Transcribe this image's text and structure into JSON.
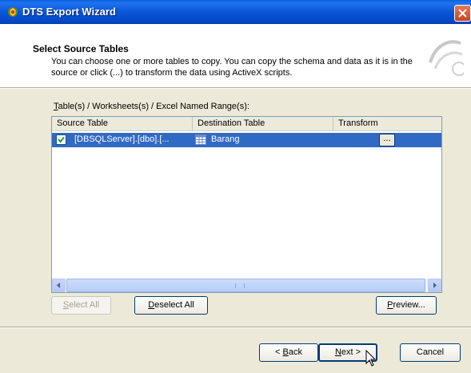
{
  "window": {
    "title": "DTS Export Wizard"
  },
  "header": {
    "title": "Select Source Tables",
    "description_line1": "You can choose one or more tables to copy.  You can copy the schema and data as it is in the",
    "description_line2": "source or click (...) to transform the data using ActiveX scripts."
  },
  "list": {
    "caption_accel": "T",
    "caption_rest": "able(s) / Worksheets(s) / Excel Named Range(s):",
    "columns": [
      "Source Table",
      "Destination Table",
      "Transform"
    ],
    "rows": [
      {
        "checked": true,
        "source": "[DBSQLServer].[dbo].[...",
        "destination": "Barang",
        "transform_button": "..."
      }
    ]
  },
  "buttons": {
    "select_all_accel": "S",
    "select_all_rest": "elect All",
    "deselect_all_accel": "D",
    "deselect_all_rest": "eselect All",
    "preview_accel": "P",
    "preview_rest": "review...",
    "back_prefix": "< ",
    "back_accel": "B",
    "back_rest": "ack",
    "next_accel": "N",
    "next_rest": "ext >",
    "cancel": "Cancel"
  },
  "colors": {
    "title_bar": "#0a56d8",
    "selection": "#316ac5",
    "dialog_face": "#ece9d8"
  }
}
